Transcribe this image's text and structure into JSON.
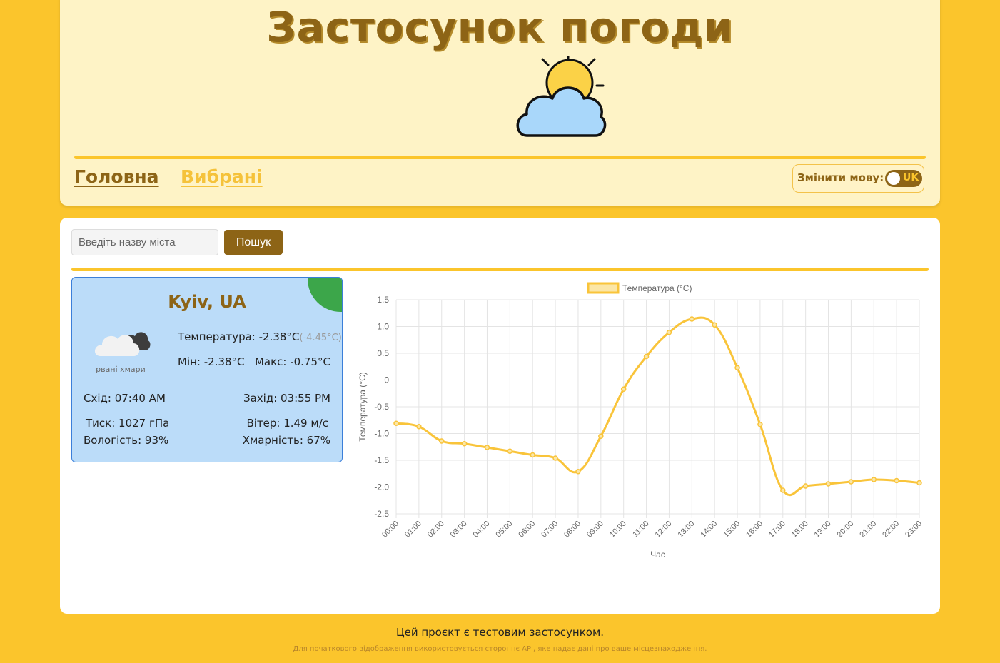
{
  "header": {
    "title": "Застосунок погоди",
    "nav": {
      "home": "Головна",
      "favorites": "Вибрані"
    },
    "language": {
      "label": "Змінити мову:",
      "code": "UK"
    }
  },
  "search": {
    "placeholder": "Введіть назву міста",
    "button": "Пошук"
  },
  "weather": {
    "city": "Kyiv, UA",
    "description": "рвані хмари",
    "temp_label": "Температура:",
    "temp": "-2.38°C",
    "feels_like": "(-4.45°C)",
    "min": "Мін: -2.38°C",
    "max": "Макс: -0.75°C",
    "sunrise": "Схід: 07:40 AM",
    "sunset": "Захід: 03:55 PM",
    "pressure": "Тиск: 1027 гПа",
    "wind": "Вітер: 1.49 м/с",
    "humidity": "Вологість: 93%",
    "clouds": "Хмарність: 67%"
  },
  "chart_data": {
    "type": "line",
    "legend": "Температура (°C)",
    "xlabel": "Час",
    "ylabel": "Температура (°C)",
    "ylim": [
      -2.5,
      1.5
    ],
    "yticks": [
      "1.5",
      "1.0",
      "0.5",
      "0",
      "-0.5",
      "-1.0",
      "-1.5",
      "-2.0",
      "-2.5"
    ],
    "categories": [
      "00:00",
      "01:00",
      "02:00",
      "03:00",
      "04:00",
      "05:00",
      "06:00",
      "07:00",
      "08:00",
      "09:00",
      "10:00",
      "11:00",
      "12:00",
      "13:00",
      "14:00",
      "15:00",
      "16:00",
      "17:00",
      "18:00",
      "19:00",
      "20:00",
      "21:00",
      "22:00",
      "23:00"
    ],
    "series": [
      {
        "name": "Температура (°C)",
        "values": [
          -0.81,
          -0.87,
          -1.14,
          -1.19,
          -1.26,
          -1.33,
          -1.4,
          -1.46,
          -1.71,
          -1.05,
          -0.17,
          0.44,
          0.89,
          1.14,
          1.03,
          0.23,
          -0.83,
          -2.06,
          -1.98,
          -1.94,
          -1.9,
          -1.86,
          -1.88,
          -1.92
        ]
      }
    ],
    "color": "#f9c43a",
    "grid": true,
    "legend_position": "top"
  },
  "footer": {
    "note": "Цей проєкт є тестовим застосунком.",
    "small": "Для початкового відображення використовується стороннє API, яке надає дані про ваше місцезнаходження."
  }
}
